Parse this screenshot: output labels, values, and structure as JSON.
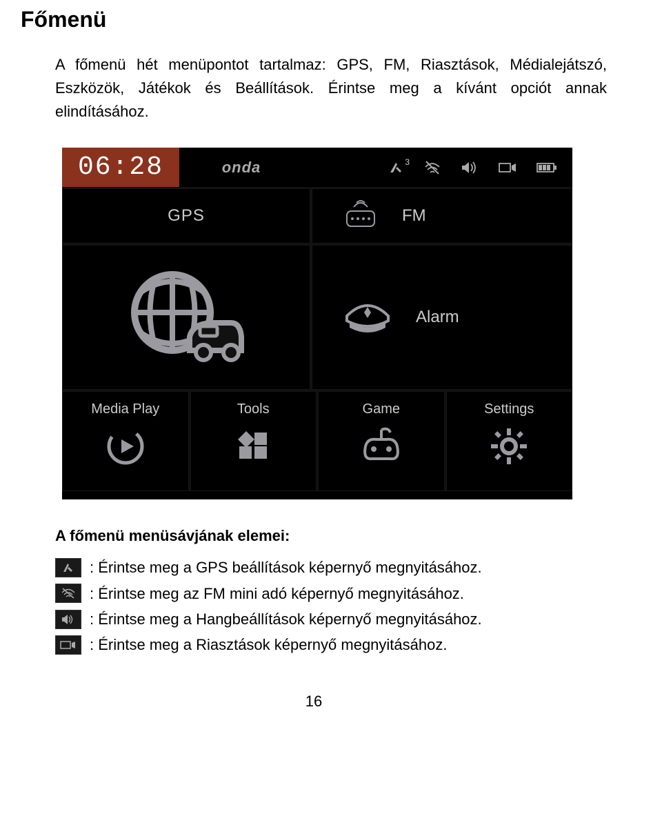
{
  "heading": "Főmenü",
  "intro": "A főmenü hét menüpontot tartalmaz: GPS, FM, Riasztások, Médialejátszó, Eszközök, Játékok és Beállítások. Érintse meg a kívánt opciót annak elindításához.",
  "device": {
    "clock": "06:28",
    "brand": "onda",
    "sat_count": "3",
    "tiles": {
      "gps": "GPS",
      "fm": "FM",
      "alarm": "Alarm",
      "media": "Media Play",
      "tools": "Tools",
      "game": "Game",
      "settings": "Settings"
    }
  },
  "legend": {
    "title": "A főmenü menüsávjának elemei:",
    "items": [
      ": Érintse meg a GPS beállítások képernyő megnyitásához.",
      ": Érintse meg az FM mini adó képernyő megnyitásához.",
      ": Érintse meg a Hangbeállítások képernyő megnyitásához.",
      ": Érintse meg a Riasztások képernyő megnyitásához."
    ]
  },
  "page_number": "16"
}
